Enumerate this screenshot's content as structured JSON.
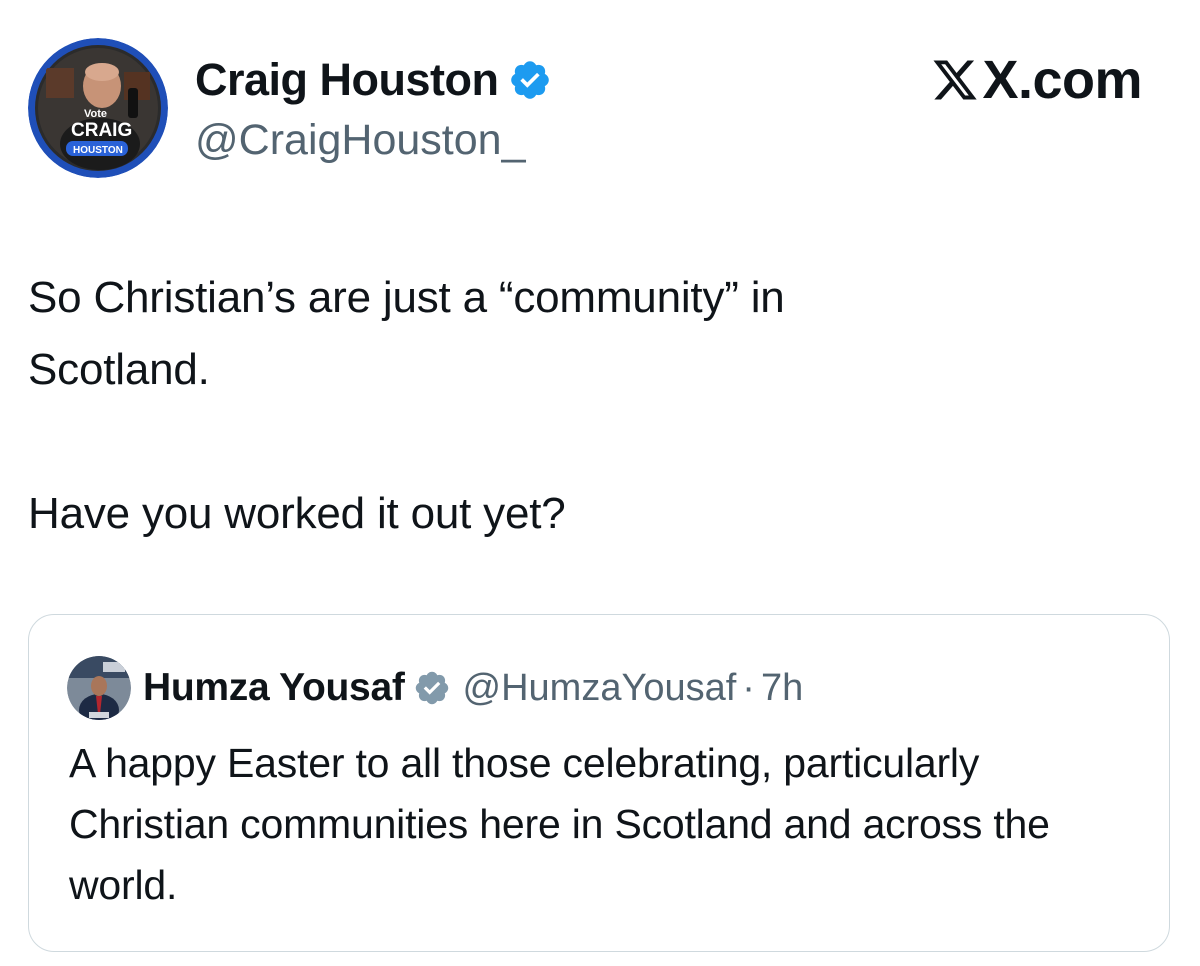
{
  "tweet": {
    "author": {
      "display_name": "Craig Houston",
      "handle": "@CraigHouston_",
      "avatar_text": [
        "Vote",
        "CRAIG",
        "HOUSTON"
      ],
      "verified": true
    },
    "brand": "X.com",
    "text": "So Christian’s are just a “community” in\nScotland.\n\nHave you worked it out yet?"
  },
  "quote": {
    "author": {
      "display_name": "Humza Yousaf",
      "handle": "@HumzaYousaf",
      "verified": true
    },
    "separator": "·",
    "time": "7h",
    "text": "A happy Easter to all those celebrating, particularly Christian communities here in Scotland and across the world."
  },
  "colors": {
    "verified_blue": "#1d9bf0",
    "verified_gray": "#829aab",
    "secondary_text": "#536471",
    "border": "#cfd9de"
  },
  "icons": {
    "verified": "verified-badge-icon",
    "brand": "x-logo-icon"
  }
}
